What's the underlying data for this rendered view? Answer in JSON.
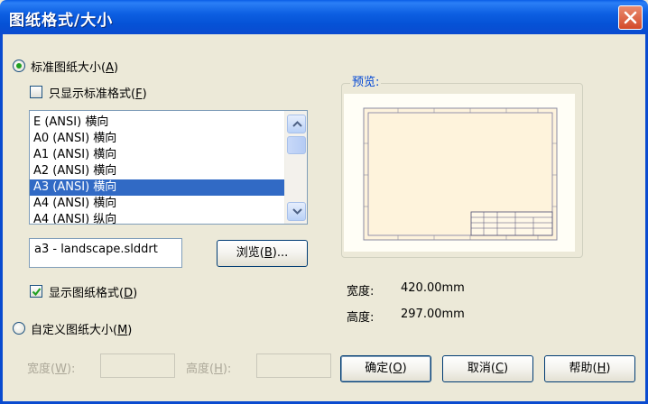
{
  "window": {
    "title": "图纸格式/大小"
  },
  "standard": {
    "radio_label": "标准图纸大小(",
    "radio_key": "A",
    "radio_tail": ")",
    "show_std_label": "只显示标准格式(",
    "show_std_key": "F",
    "show_std_tail": ")"
  },
  "paper_list": {
    "items": [
      "E (ANSI) 横向",
      "A0 (ANSI) 横向",
      "A1 (ANSI) 横向",
      "A2 (ANSI) 横向",
      "A3 (ANSI) 横向",
      "A4 (ANSI) 横向",
      "A4 (ANSI) 纵向"
    ],
    "selected": "A3 (ANSI) 横向"
  },
  "file": {
    "value": "a3 - landscape.slddrt",
    "browse_label": "浏览(",
    "browse_key": "B",
    "browse_tail": ")..."
  },
  "display_format": {
    "label": "显示图纸格式(",
    "key": "D",
    "tail": ")",
    "checked": true
  },
  "custom": {
    "radio_label": "自定义图纸大小(",
    "radio_key": "M",
    "radio_tail": ")",
    "width_label": "宽度(",
    "width_key": "W",
    "width_tail": "):",
    "height_label": "高度(",
    "height_key": "H",
    "height_tail": "):"
  },
  "preview": {
    "title": "预览:",
    "width_label": "宽度:",
    "width_value": "420.00mm",
    "height_label": "高度:",
    "height_value": "297.00mm"
  },
  "buttons": {
    "ok_label": "确定(",
    "ok_key": "O",
    "ok_tail": ")",
    "cancel_label": "取消(",
    "cancel_key": "C",
    "cancel_tail": ")",
    "help_label": "帮助(",
    "help_key": "H",
    "help_tail": ")"
  },
  "colors": {
    "titlebar": "#0a5de6",
    "selection": "#316ac5",
    "radio_dot": "#21a121",
    "group_title": "#0046d5"
  }
}
